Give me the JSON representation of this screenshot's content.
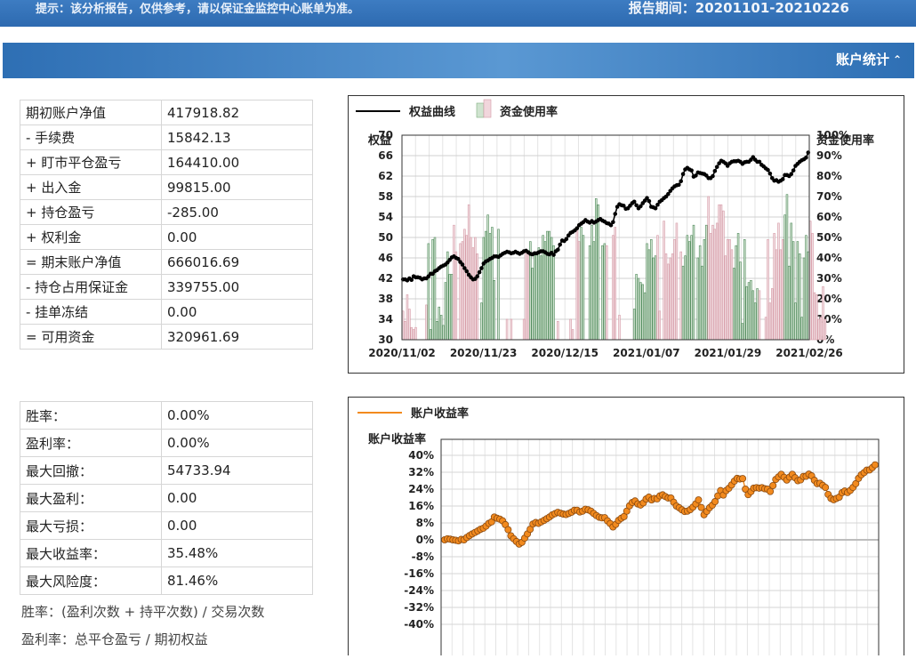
{
  "header": {
    "notice": "提示：该分析报告，仅供参考，请以保证金监控中心账单为准。",
    "period_label": "报告期间：",
    "period_value": "20201101-20210226"
  },
  "section": {
    "title": "账户统计",
    "collapse_icon": "double-chevron-up-icon"
  },
  "account": [
    {
      "label": "期初账户净值",
      "value": "417918.82"
    },
    {
      "label": "- 手续费",
      "value": "15842.13"
    },
    {
      "label": "+ 盯市平仓盈亏",
      "value": "164410.00"
    },
    {
      "label": "+ 出入金",
      "value": "99815.00"
    },
    {
      "label": "+ 持仓盈亏",
      "value": "-285.00"
    },
    {
      "label": "+ 权利金",
      "value": "0.00"
    },
    {
      "label": "= 期末账户净值",
      "value": "666016.69"
    },
    {
      "label": "- 持仓占用保证金",
      "value": "339755.00"
    },
    {
      "label": "- 挂单冻结",
      "value": "0.00"
    },
    {
      "label": "= 可用资金",
      "value": "320961.69"
    }
  ],
  "ratios": [
    {
      "label": "胜率：",
      "value": "0.00%"
    },
    {
      "label": "盈利率：",
      "value": "0.00%"
    },
    {
      "label": "最大回撤：",
      "value": "54733.94"
    },
    {
      "label": "最大盈利：",
      "value": "0.00"
    },
    {
      "label": "最大亏损：",
      "value": "0.00"
    },
    {
      "label": "最大收益率：",
      "value": "35.48%"
    },
    {
      "label": "最大风险度：",
      "value": "81.46%"
    }
  ],
  "notes": {
    "win_rate": "胜率：(盈利次数 + 持平次数) / 交易次数",
    "profit_rate": "盈利率：总平仓盈亏 / 期初权益"
  },
  "chart_data": [
    {
      "type": "line+bar",
      "legend": [
        "权益曲线",
        "资金使用率"
      ],
      "ylabel_left": "权益",
      "ylabel_right": "资金使用率",
      "y_ticks_left": [
        "30",
        "34",
        "38",
        "42",
        "46",
        "50",
        "54",
        "58",
        "62",
        "66",
        "70"
      ],
      "y_ticks_right": [
        "0%",
        "10%",
        "20%",
        "30%",
        "40%",
        "50%",
        "60%",
        "70%",
        "80%",
        "90%",
        "100%"
      ],
      "x_ticks": [
        "2020/11/02",
        "2020/11/23",
        "2020/12/15",
        "2021/01/07",
        "2021/01/29",
        "2021/02/26"
      ],
      "ylim_left": [
        30,
        70
      ],
      "ylim_right": [
        0,
        100
      ],
      "equity": [
        41.8,
        41.8,
        41.6,
        42.0,
        41.7,
        42.4,
        42.2,
        42.2,
        42.1,
        41.8,
        42.0,
        42.0,
        42.4,
        42.9,
        42.9,
        43.4,
        43.6,
        44.0,
        44.3,
        44.5,
        44.7,
        45.1,
        45.6,
        46.1,
        46.3,
        46.0,
        45.8,
        45.2,
        44.7,
        44.0,
        43.4,
        42.7,
        42.2,
        41.8,
        41.9,
        42.4,
        43.2,
        44.0,
        44.9,
        45.3,
        45.5,
        45.8,
        46.0,
        46.3,
        46.3,
        46.2,
        46.5,
        46.8,
        47.0,
        47.2,
        47.1,
        46.9,
        47.0,
        47.2,
        47.0,
        46.8,
        47.0,
        47.3,
        47.4,
        47.1,
        46.8,
        46.7,
        46.9,
        46.9,
        47.1,
        47.3,
        47.3,
        47.1,
        46.8,
        46.7,
        47.0,
        46.6,
        47.3,
        47.6,
        48.6,
        49.4,
        49.3,
        49.7,
        50.4,
        50.9,
        51.1,
        51.4,
        51.8,
        52.4,
        52.7,
        53.0,
        53.4,
        53.1,
        52.9,
        53.2,
        52.9,
        53.1,
        53.4,
        53.6,
        53.3,
        53.1,
        52.8,
        52.7,
        52.4,
        53.0,
        54.6,
        56.0,
        56.5,
        56.3,
        56.2,
        55.6,
        55.7,
        56.2,
        56.7,
        57.0,
        56.3,
        55.7,
        56.1,
        56.7,
        57.2,
        57.7,
        57.1,
        56.0,
        55.9,
        55.7,
        56.4,
        57.0,
        57.3,
        57.7,
        58.0,
        58.5,
        59.1,
        59.6,
        60.0,
        60.2,
        60.3,
        61.0,
        62.4,
        63.3,
        63.6,
        63.3,
        63.1,
        61.9,
        62.1,
        62.7,
        62.6,
        62.5,
        62.4,
        62.1,
        61.6,
        61.6,
        62.0,
        63.0,
        63.8,
        64.5,
        65.0,
        64.8,
        64.5,
        64.0,
        64.5,
        64.8,
        64.9,
        64.9,
        65.0,
        64.8,
        64.4,
        64.7,
        64.8,
        64.8,
        65.2,
        65.7,
        65.2,
        64.8,
        64.8,
        64.2,
        63.9,
        63.5,
        63.2,
        62.5,
        61.6,
        61.1,
        61.2,
        60.9,
        61.1,
        61.4,
        62.2,
        62.2,
        62.0,
        62.4,
        63.1,
        64.0,
        64.4,
        64.8,
        65.1,
        65.3,
        65.6,
        66.6
      ],
      "usage": [
        14,
        9,
        22,
        15,
        6,
        5,
        6,
        0,
        0,
        0,
        0,
        17,
        47,
        5,
        49,
        50,
        9,
        16,
        12,
        7,
        28,
        43,
        32,
        32,
        56,
        43,
        0,
        47,
        48,
        54,
        51,
        66,
        50,
        45,
        50,
        42,
        0,
        18,
        50,
        53,
        61,
        52,
        55,
        29,
        0,
        54,
        0,
        0,
        0,
        10,
        0,
        10,
        0,
        0,
        0,
        0,
        0,
        10,
        43,
        43,
        48,
        35,
        41,
        42,
        45,
        41,
        51,
        48,
        53,
        53,
        50,
        46,
        0,
        9,
        0,
        0,
        0,
        0,
        0,
        10,
        5,
        0,
        55,
        48,
        55,
        51,
        0,
        0,
        46,
        56,
        48,
        69,
        66,
        0,
        46,
        47,
        46,
        0,
        0,
        51,
        55,
        0,
        12,
        0,
        0,
        0,
        0,
        0,
        0,
        15,
        32,
        30,
        28,
        27,
        23,
        47,
        44,
        49,
        40,
        41,
        51,
        14,
        0,
        58,
        42,
        37,
        40,
        42,
        49,
        57,
        0,
        43,
        36,
        41,
        51,
        48,
        51,
        56,
        0,
        40,
        46,
        36,
        49,
        56,
        70,
        52,
        56,
        54,
        57,
        66,
        66,
        63,
        41,
        49,
        49,
        44,
        35,
        46,
        52,
        38,
        8,
        49,
        26,
        28,
        29,
        24,
        18,
        25,
        24,
        0,
        0,
        11,
        49,
        18,
        25,
        52,
        44,
        57,
        44,
        49,
        61,
        71,
        36,
        57,
        48,
        18,
        48,
        42,
        11,
        40,
        51,
        43,
        58,
        52,
        23,
        22,
        10,
        11,
        26,
        10
      ],
      "equity_color": "#000000",
      "usage_colors": [
        "#f2dfe3",
        "#a8c8a8",
        "#d69aa6",
        "#4f8a5a"
      ]
    },
    {
      "type": "line",
      "legend": [
        "账户收益率"
      ],
      "ylabel": "账户收益率",
      "y_ticks": [
        "40%",
        "32%",
        "24%",
        "16%",
        "8%",
        "0%",
        "-8%",
        "-16%",
        "-24%",
        "-32%",
        "-40%"
      ],
      "ylim": [
        -40,
        40
      ],
      "returns": [
        0.0,
        0.5,
        0.3,
        0.0,
        -0.2,
        -0.5,
        0.2,
        0.0,
        1.1,
        2.0,
        2.8,
        3.5,
        4.2,
        5.0,
        5.5,
        6.5,
        7.8,
        8.5,
        10.8,
        10.2,
        9.8,
        9.0,
        7.2,
        4.8,
        1.9,
        0.5,
        -0.8,
        -2.0,
        -1.2,
        0.8,
        2.8,
        5.0,
        7.5,
        8.2,
        7.8,
        8.5,
        9.2,
        10.0,
        10.8,
        11.8,
        12.4,
        13.0,
        12.6,
        12.2,
        12.0,
        12.5,
        13.1,
        14.0,
        14.0,
        13.2,
        13.6,
        14.5,
        14.2,
        13.6,
        12.5,
        11.5,
        10.7,
        10.4,
        10.5,
        9.0,
        7.7,
        6.1,
        7.3,
        9.2,
        10.2,
        11.0,
        13.6,
        16.1,
        17.7,
        18.4,
        17.0,
        16.5,
        17.5,
        19.3,
        20.2,
        18.9,
        19.6,
        19.4,
        20.8,
        21.3,
        20.5,
        19.8,
        19.8,
        17.8,
        16.0,
        15.2,
        14.2,
        13.4,
        13.6,
        14.3,
        15.5,
        17.0,
        18.9,
        15.3,
        11.9,
        13.5,
        15.2,
        16.4,
        18.1,
        20.8,
        23.3,
        21.2,
        23.3,
        24.4,
        26.0,
        27.8,
        29.1,
        28.8,
        29.0,
        24.0,
        21.4,
        22.8,
        24.5,
        24.7,
        24.5,
        24.7,
        24.2,
        24.0,
        22.9,
        25.7,
        28.6,
        29.8,
        31.0,
        29.6,
        28.3,
        29.7,
        31.0,
        29.4,
        28.0,
        28.4,
        30.0,
        30.1,
        31.1,
        30.3,
        28.2,
        26.6,
        26.8,
        25.8,
        24.8,
        21.5,
        19.6,
        19.0,
        19.6,
        20.2,
        22.3,
        23.1,
        22.4,
        23.4,
        24.8,
        26.6,
        29.1,
        30.8,
        31.8,
        33.0,
        33.1,
        34.2,
        35.5
      ],
      "line_color": "#f28a1e",
      "marker_color": "#d8731a"
    }
  ]
}
